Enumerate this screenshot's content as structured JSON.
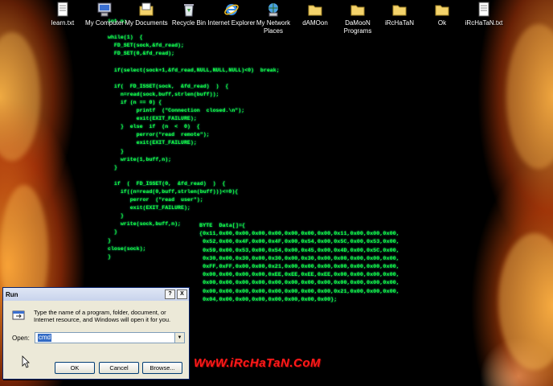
{
  "desktop": {
    "icons": [
      {
        "label": "learn.txt",
        "icon": "text-file-icon"
      },
      {
        "label": "My Computer",
        "icon": "computer-icon"
      },
      {
        "label": "My Documents",
        "icon": "documents-folder-icon"
      },
      {
        "label": "Recycle Bin",
        "icon": "recycle-bin-icon"
      },
      {
        "label": "Internet Explorer",
        "icon": "internet-explorer-icon"
      },
      {
        "label": "My Network Places",
        "icon": "network-places-icon"
      },
      {
        "label": "dAMOon",
        "icon": "folder-icon"
      },
      {
        "label": "DaMooN Programs",
        "icon": "folder-icon"
      },
      {
        "label": "iRcHaTaN",
        "icon": "folder-icon"
      },
      {
        "label": "Ok",
        "icon": "folder-icon"
      },
      {
        "label": "iRcHaTaN.txt",
        "icon": "text-file-icon"
      }
    ],
    "code_left": "int n;\n\nwhile(1)  {\n  FD_SET(sock,&fd_read);\n  FD_SET(0,&fd_read);\n\n  if(select(sock+1,&fd_read,NULL,NULL,NULL)<0)  break;\n\n  if(  FD_ISSET(sock,  &fd_read)  )  {\n    n=read(sock,buff,strlen(buff));\n    if (n == 0) {\n         printf  (\"Connection  closed.\\n\");\n         exit(EXIT_FAILURE);\n    }  else  if  (n  <  0)  {\n         perror(\"read  remote\");\n         exit(EXIT_FAILURE);\n    }\n    write(1,buff,n);\n  }\n\n  if  (  FD_ISSET(0,  &fd_read)  )  {\n    if((n=read(0,buff,strlen(buff)))<=0){\n       perror  (\"read  user\");\n       exit(EXIT_FAILURE);\n    }\n    write(sock,buff,n);\n  }\n}\nclose(sock);\n}",
    "code_right": "BYTE  Data[]={\n{0x11,0x00,0x00,0x00,0x00,0x00,0x00,0x00,0x11,0x00,0x00,0x00,\n 0x52,0x00,0x4F,0x00,0x4F,0x00,0x54,0x00,0x5C,0x00,0x53,0x00,\n 0x59,0x00,0x53,0x00,0x54,0x00,0x45,0x00,0x4D,0x00,0x5C,0x00,\n 0x30,0x00,0x30,0x00,0x30,0x00,0x30,0x00,0x00,0x00,0x00,0x00,\n 0xFF,0xFF,0x00,0x00,0x21,0x00,0x00,0x00,0x00,0x00,0x00,0x00,\n 0x00,0x00,0x00,0x00,0xEE,0xEE,0xEE,0xEE,0x00,0x00,0x00,0x00,\n 0x00,0x00,0x00,0x00,0x00,0x00,0x00,0x00,0x00,0x00,0x00,0x00,\n 0x00,0x00,0x00,0x00,0x00,0x00,0x00,0x00,0x21,0x00,0x00,0x00,\n 0x04,0x00,0x00,0x00,0x00,0x00,0x00,0x00};",
    "watermark": "WwW.iRcHaTaN.CoM"
  },
  "run_dialog": {
    "title": "Run",
    "help_button": "?",
    "close_button": "X",
    "description": "Type the name of a program, folder, document, or Internet resource, and Windows will open it for you.",
    "open_label": "Open:",
    "open_value": "cmd",
    "buttons": {
      "ok": "OK",
      "cancel": "Cancel",
      "browse": "Browse..."
    }
  },
  "colors": {
    "code": "#19ff3a",
    "watermark": "#ff1a1a",
    "dialog_bg": "#ece9d8"
  }
}
